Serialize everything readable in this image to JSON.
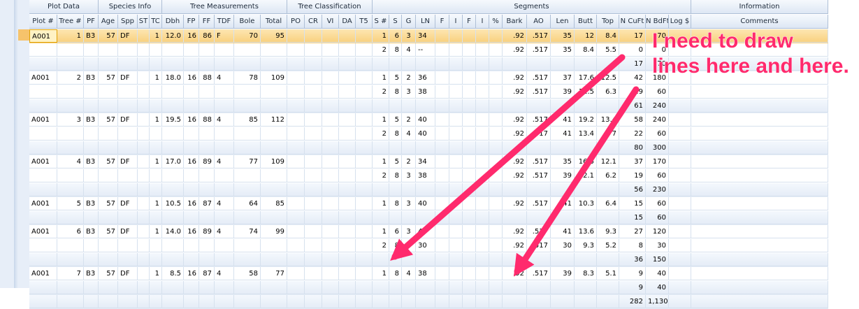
{
  "groups": [
    "Plot Data",
    "Species Info",
    "Tree Measurements",
    "Tree Classification",
    "Segments",
    "Information"
  ],
  "columns": [
    "Plot #",
    "Tree #",
    "PF",
    "Age",
    "Spp",
    "ST",
    "TC",
    "Dbh",
    "FP",
    "FF",
    "TDF",
    "Bole",
    "Total",
    "PO",
    "CR",
    "VI",
    "DA",
    "T5",
    "S #",
    "S",
    "G",
    "LN",
    "F",
    "I",
    "F",
    "I",
    "%",
    "Bark",
    "AO",
    "Len",
    "Butt",
    "Top",
    "N CuFt",
    "N BdFt",
    "Log $",
    "Comments"
  ],
  "rows": [
    {
      "kind": "tree",
      "selected": true,
      "cells": [
        "A001",
        "1",
        "B3",
        "57",
        "DF",
        "",
        "1",
        "12.0",
        "16",
        "86",
        "F",
        "70",
        "95",
        "",
        "",
        "",
        "",
        "",
        "1",
        "6",
        "3",
        "34",
        "",
        "",
        "",
        "",
        "",
        ".92",
        ".517",
        "35",
        "12",
        "8.4",
        "17",
        "70",
        "",
        ""
      ]
    },
    {
      "kind": "seg",
      "cells": [
        "",
        "",
        "",
        "",
        "",
        "",
        "",
        "",
        "",
        "",
        "",
        "",
        "",
        "",
        "",
        "",
        "",
        "",
        "2",
        "8",
        "4",
        "--",
        "",
        "",
        "",
        "",
        "",
        ".92",
        ".517",
        "35",
        "8.4",
        "5.5",
        "0",
        "0",
        "",
        ""
      ]
    },
    {
      "kind": "total",
      "cells": [
        "",
        "",
        "",
        "",
        "",
        "",
        "",
        "",
        "",
        "",
        "",
        "",
        "",
        "",
        "",
        "",
        "",
        "",
        "",
        "",
        "",
        "",
        "",
        "",
        "",
        "",
        "",
        "",
        "",
        "",
        "",
        "",
        "17",
        "70",
        "",
        ""
      ]
    },
    {
      "kind": "tree",
      "cells": [
        "A001",
        "2",
        "B3",
        "57",
        "DF",
        "",
        "1",
        "18.0",
        "16",
        "88",
        "4",
        "78",
        "109",
        "",
        "",
        "",
        "",
        "",
        "1",
        "5",
        "2",
        "36",
        "",
        "",
        "",
        "",
        "",
        ".92",
        ".517",
        "37",
        "17.6",
        "12.5",
        "42",
        "180",
        "",
        ""
      ]
    },
    {
      "kind": "seg",
      "cells": [
        "",
        "",
        "",
        "",
        "",
        "",
        "",
        "",
        "",
        "",
        "",
        "",
        "",
        "",
        "",
        "",
        "",
        "",
        "2",
        "8",
        "3",
        "38",
        "",
        "",
        "",
        "",
        "",
        ".92",
        ".517",
        "39",
        "12.5",
        "6.3",
        "19",
        "60",
        "",
        ""
      ]
    },
    {
      "kind": "total",
      "cells": [
        "",
        "",
        "",
        "",
        "",
        "",
        "",
        "",
        "",
        "",
        "",
        "",
        "",
        "",
        "",
        "",
        "",
        "",
        "",
        "",
        "",
        "",
        "",
        "",
        "",
        "",
        "",
        "",
        "",
        "",
        "",
        "",
        "61",
        "240",
        "",
        ""
      ]
    },
    {
      "kind": "tree",
      "cells": [
        "A001",
        "3",
        "B3",
        "57",
        "DF",
        "",
        "1",
        "19.5",
        "16",
        "88",
        "4",
        "85",
        "112",
        "",
        "",
        "",
        "",
        "",
        "1",
        "5",
        "2",
        "40",
        "",
        "",
        "",
        "",
        "",
        ".92",
        ".517",
        "41",
        "19.2",
        "13.4",
        "58",
        "240",
        "",
        ""
      ]
    },
    {
      "kind": "seg",
      "cells": [
        "",
        "",
        "",
        "",
        "",
        "",
        "",
        "",
        "",
        "",
        "",
        "",
        "",
        "",
        "",
        "",
        "",
        "",
        "2",
        "8",
        "4",
        "40",
        "",
        "",
        "",
        "",
        "",
        ".92",
        ".517",
        "41",
        "13.4",
        "7",
        "22",
        "60",
        "",
        ""
      ]
    },
    {
      "kind": "total",
      "cells": [
        "",
        "",
        "",
        "",
        "",
        "",
        "",
        "",
        "",
        "",
        "",
        "",
        "",
        "",
        "",
        "",
        "",
        "",
        "",
        "",
        "",
        "",
        "",
        "",
        "",
        "",
        "",
        "",
        "",
        "",
        "",
        "",
        "80",
        "300",
        "",
        ""
      ]
    },
    {
      "kind": "tree",
      "cells": [
        "A001",
        "4",
        "B3",
        "57",
        "DF",
        "",
        "1",
        "17.0",
        "16",
        "89",
        "4",
        "77",
        "109",
        "",
        "",
        "",
        "",
        "",
        "1",
        "5",
        "2",
        "34",
        "",
        "",
        "",
        "",
        "",
        ".92",
        ".517",
        "35",
        "16.5",
        "12.1",
        "37",
        "170",
        "",
        ""
      ]
    },
    {
      "kind": "seg",
      "cells": [
        "",
        "",
        "",
        "",
        "",
        "",
        "",
        "",
        "",
        "",
        "",
        "",
        "",
        "",
        "",
        "",
        "",
        "",
        "2",
        "8",
        "3",
        "38",
        "",
        "",
        "",
        "",
        "",
        ".92",
        ".517",
        "39",
        "12.1",
        "6.2",
        "19",
        "60",
        "",
        ""
      ]
    },
    {
      "kind": "total",
      "cells": [
        "",
        "",
        "",
        "",
        "",
        "",
        "",
        "",
        "",
        "",
        "",
        "",
        "",
        "",
        "",
        "",
        "",
        "",
        "",
        "",
        "",
        "",
        "",
        "",
        "",
        "",
        "",
        "",
        "",
        "",
        "",
        "",
        "56",
        "230",
        "",
        ""
      ]
    },
    {
      "kind": "tree",
      "cells": [
        "A001",
        "5",
        "B3",
        "57",
        "DF",
        "",
        "1",
        "10.5",
        "16",
        "87",
        "4",
        "64",
        "85",
        "",
        "",
        "",
        "",
        "",
        "1",
        "8",
        "3",
        "40",
        "",
        "",
        "",
        "",
        "",
        ".92",
        ".517",
        "41",
        "10.3",
        "6.4",
        "15",
        "60",
        "",
        ""
      ]
    },
    {
      "kind": "total",
      "cells": [
        "",
        "",
        "",
        "",
        "",
        "",
        "",
        "",
        "",
        "",
        "",
        "",
        "",
        "",
        "",
        "",
        "",
        "",
        "",
        "",
        "",
        "",
        "",
        "",
        "",
        "",
        "",
        "",
        "",
        "",
        "",
        "",
        "15",
        "60",
        "",
        ""
      ]
    },
    {
      "kind": "tree",
      "cells": [
        "A001",
        "6",
        "B3",
        "57",
        "DF",
        "",
        "1",
        "14.0",
        "16",
        "89",
        "4",
        "74",
        "99",
        "",
        "",
        "",
        "",
        "",
        "1",
        "6",
        "3",
        "40",
        "",
        "",
        "",
        "",
        "",
        ".92",
        ".517",
        "41",
        "13.6",
        "9.3",
        "27",
        "120",
        "",
        ""
      ]
    },
    {
      "kind": "seg",
      "cells": [
        "",
        "",
        "",
        "",
        "",
        "",
        "",
        "",
        "",
        "",
        "",
        "",
        "",
        "",
        "",
        "",
        "",
        "",
        "2",
        "8",
        "4",
        "30",
        "",
        "",
        "",
        "",
        "",
        ".92",
        ".517",
        "30",
        "9.3",
        "5.2",
        "8",
        "30",
        "",
        ""
      ]
    },
    {
      "kind": "total",
      "cells": [
        "",
        "",
        "",
        "",
        "",
        "",
        "",
        "",
        "",
        "",
        "",
        "",
        "",
        "",
        "",
        "",
        "",
        "",
        "",
        "",
        "",
        "",
        "",
        "",
        "",
        "",
        "",
        "",
        "",
        "",
        "",
        "",
        "36",
        "150",
        "",
        ""
      ]
    },
    {
      "kind": "tree",
      "cells": [
        "A001",
        "7",
        "B3",
        "57",
        "DF",
        "",
        "1",
        "8.5",
        "16",
        "87",
        "4",
        "58",
        "77",
        "",
        "",
        "",
        "",
        "",
        "1",
        "8",
        "4",
        "38",
        "",
        "",
        "",
        "",
        "",
        ".92",
        ".517",
        "39",
        "8.3",
        "5.1",
        "9",
        "40",
        "",
        ""
      ]
    },
    {
      "kind": "total",
      "cells": [
        "",
        "",
        "",
        "",
        "",
        "",
        "",
        "",
        "",
        "",
        "",
        "",
        "",
        "",
        "",
        "",
        "",
        "",
        "",
        "",
        "",
        "",
        "",
        "",
        "",
        "",
        "",
        "",
        "",
        "",
        "",
        "",
        "9",
        "40",
        "",
        ""
      ]
    },
    {
      "kind": "grand",
      "cells": [
        "",
        "",
        "",
        "",
        "",
        "",
        "",
        "",
        "",
        "",
        "",
        "",
        "",
        "",
        "",
        "",
        "",
        "",
        "",
        "",
        "",
        "",
        "",
        "",
        "",
        "",
        "",
        "",
        "",
        "",
        "",
        "",
        "282",
        "1,130",
        "",
        ""
      ]
    }
  ],
  "annotation": {
    "line1": "I need to draw",
    "line2": "lines here and here.",
    "color": "#ff2a6d"
  }
}
